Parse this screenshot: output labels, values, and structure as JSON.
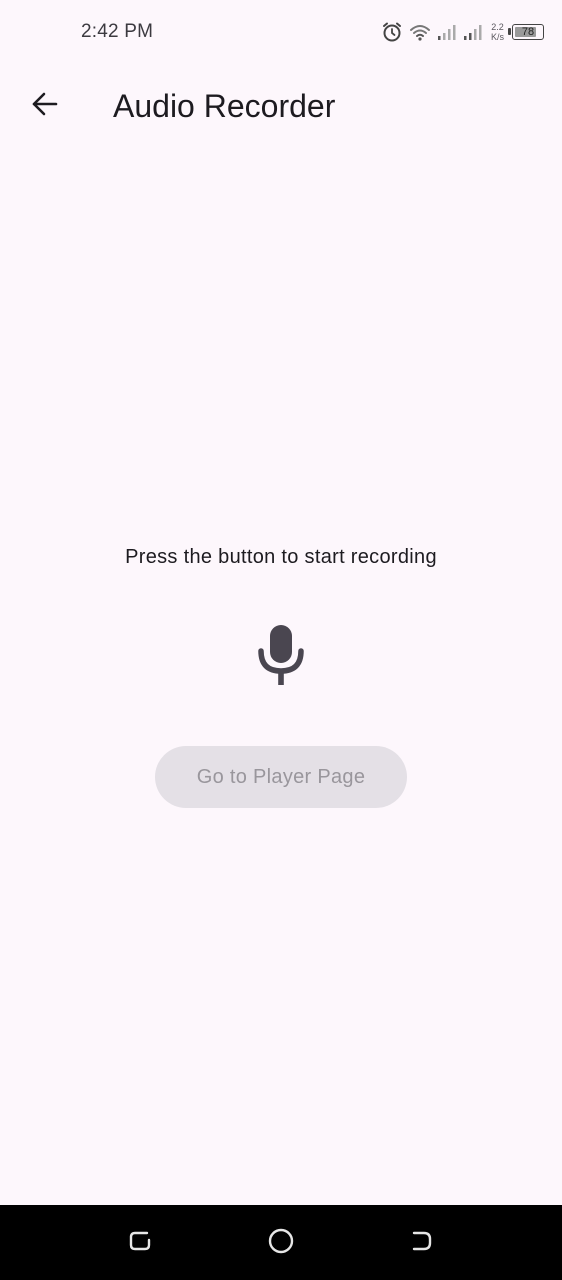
{
  "status_bar": {
    "time": "2:42 PM",
    "net_speed_value": "2.2",
    "net_speed_unit": "K/s",
    "battery_level": "78",
    "icons": [
      "alarm-icon",
      "wifi-icon",
      "signal-icon-1",
      "signal-icon-2",
      "battery-icon"
    ]
  },
  "app_bar": {
    "back_icon": "arrow-left-icon",
    "title": "Audio Recorder"
  },
  "main": {
    "prompt": "Press the button to start recording",
    "record_icon": "microphone-icon",
    "player_button_label": "Go to Player Page",
    "player_button_state": "disabled"
  },
  "nav_bar": {
    "icons": [
      "recent-apps-icon",
      "home-icon",
      "back-icon"
    ]
  },
  "colors": {
    "background": "#fdf7fc",
    "text": "#1d1b20",
    "disabled_button_bg": "#e4e0e6",
    "disabled_button_text": "#99969c",
    "nav_bar": "#000000"
  }
}
